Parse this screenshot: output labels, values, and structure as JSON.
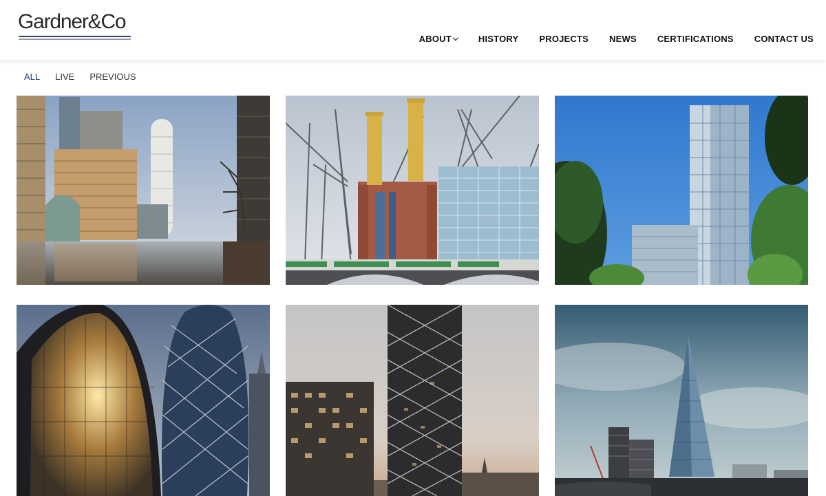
{
  "brand": {
    "logo_text": "Gardner&Co",
    "line_colors": [
      "#2d3b8f",
      "#9b9b9b"
    ]
  },
  "nav": {
    "items": [
      {
        "label": "ABOUT",
        "has_dropdown": true
      },
      {
        "label": "HISTORY"
      },
      {
        "label": "PROJECTS"
      },
      {
        "label": "NEWS"
      },
      {
        "label": "CERTIFICATIONS"
      },
      {
        "label": "CONTACT US"
      }
    ]
  },
  "filters": {
    "items": [
      "ALL",
      "LIVE",
      "PREVIOUS"
    ],
    "active": "ALL",
    "active_color": "#2b3e8c"
  },
  "gallery": {
    "tiles": [
      {
        "subject": "canary-wharf-waterfront"
      },
      {
        "subject": "battersea-power-station"
      },
      {
        "subject": "glass-tower-with-trees"
      },
      {
        "subject": "gherkin-and-curved-facade"
      },
      {
        "subject": "diagrid-residential-tower"
      },
      {
        "subject": "the-shard-skyline"
      }
    ]
  }
}
